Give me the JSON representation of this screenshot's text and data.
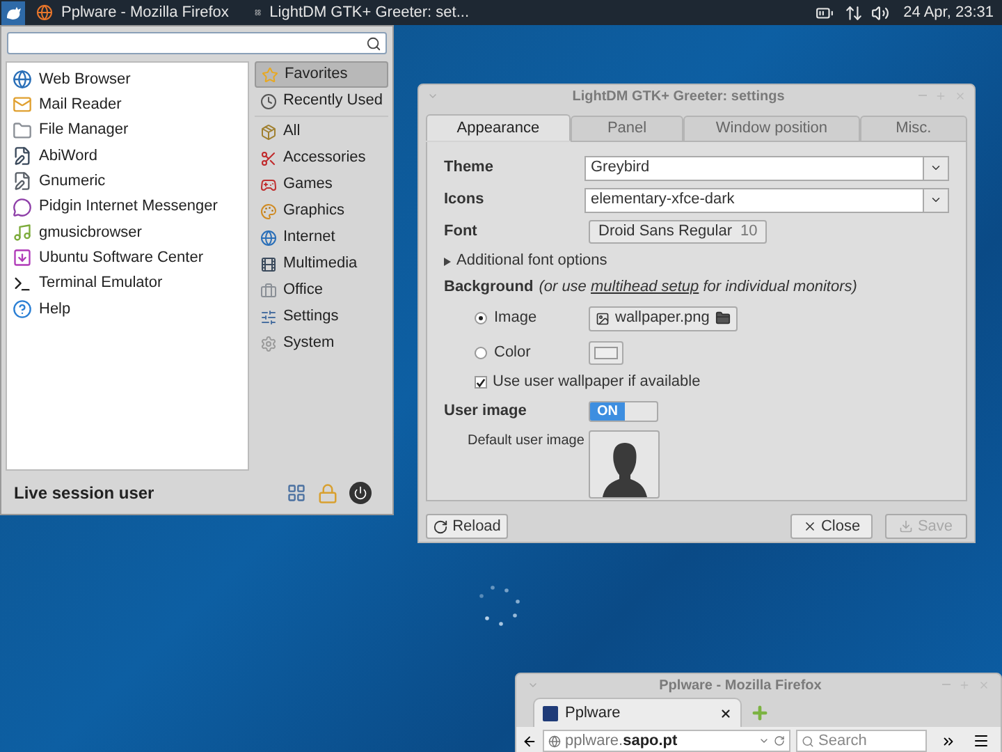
{
  "taskbar": {
    "tasks": [
      {
        "title": "Pplware - Mozilla Firefox"
      },
      {
        "title": "LightDM GTK+ Greeter: set..."
      }
    ],
    "clock": "24 Apr, 23:31"
  },
  "menu": {
    "favorites": [
      "Web Browser",
      "Mail Reader",
      "File Manager",
      "AbiWord",
      "Gnumeric",
      "Pidgin Internet Messenger",
      "gmusicbrowser",
      "Ubuntu Software Center",
      "Terminal Emulator",
      "Help"
    ],
    "categories": [
      {
        "label": "Favorites",
        "selected": true
      },
      {
        "label": "Recently Used",
        "selected": false
      },
      {
        "label": "All",
        "selected": false
      },
      {
        "label": "Accessories",
        "selected": false
      },
      {
        "label": "Games",
        "selected": false
      },
      {
        "label": "Graphics",
        "selected": false
      },
      {
        "label": "Internet",
        "selected": false
      },
      {
        "label": "Multimedia",
        "selected": false
      },
      {
        "label": "Office",
        "selected": false
      },
      {
        "label": "Settings",
        "selected": false
      },
      {
        "label": "System",
        "selected": false
      }
    ],
    "user": "Live session user"
  },
  "settings": {
    "title": "LightDM GTK+ Greeter: settings",
    "tabs": [
      {
        "label": "Appearance",
        "selected": true
      },
      {
        "label": "Panel",
        "selected": false
      },
      {
        "label": "Window position",
        "selected": false
      },
      {
        "label": "Misc.",
        "selected": false
      }
    ],
    "theme": {
      "label": "Theme",
      "value": "Greybird"
    },
    "icons": {
      "label": "Icons",
      "value": "elementary-xfce-dark"
    },
    "font": {
      "label": "Font",
      "value": "Droid Sans Regular",
      "size": "10"
    },
    "additional_font_options": {
      "label": "Additional font options",
      "expanded": false
    },
    "background": {
      "label": "Background",
      "note_start": "(or use",
      "link": "multihead setup",
      "note_end": "for individual monitors)"
    },
    "image_option": {
      "label": "Image",
      "selected": true,
      "file": "wallpaper.png"
    },
    "color_option": {
      "label": "Color",
      "selected": false
    },
    "use_user_wallpaper": {
      "label": "Use user wallpaper if available",
      "checked": true
    },
    "user_image": {
      "label": "User image",
      "on": true,
      "switch_text": "ON"
    },
    "default_user_image": {
      "label": "Default user image"
    },
    "buttons": [
      {
        "kind": "reload",
        "label": "Reload",
        "disabled": false
      },
      {
        "kind": "close",
        "label": "Close",
        "disabled": false
      },
      {
        "kind": "save",
        "label": "Save",
        "disabled": true
      }
    ]
  },
  "firefox": {
    "title": "Pplware - Mozilla Firefox",
    "tab": "Pplware",
    "url": "pplware.**sapo.pt**",
    "search_placeholder": "Search"
  }
}
